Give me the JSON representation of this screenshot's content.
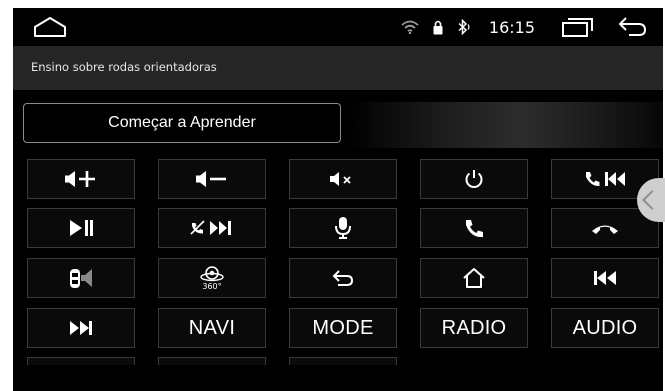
{
  "status": {
    "time": "16:15"
  },
  "header": {
    "title": "Ensino sobre rodas orientadoras"
  },
  "learn": {
    "start_label": "Começar a Aprender"
  },
  "keys": {
    "row1": [
      {
        "icon": "volume-up-icon"
      },
      {
        "icon": "volume-down-icon"
      },
      {
        "icon": "mute-icon"
      },
      {
        "icon": "power-icon"
      },
      {
        "icon": "call-prev-icon"
      }
    ],
    "row2": [
      {
        "icon": "play-pause-icon"
      },
      {
        "icon": "hangup-next-icon"
      },
      {
        "icon": "microphone-icon"
      },
      {
        "icon": "phone-answer-icon"
      },
      {
        "icon": "phone-hangup-icon"
      }
    ],
    "row3": [
      {
        "icon": "car-speaker-icon"
      },
      {
        "icon": "camera-360-icon",
        "label": "360°"
      },
      {
        "icon": "back-icon"
      },
      {
        "icon": "home-icon"
      },
      {
        "icon": "previous-track-icon"
      }
    ],
    "row4": [
      {
        "icon": "next-track-icon"
      },
      {
        "label": "NAVI"
      },
      {
        "label": "MODE"
      },
      {
        "label": "RADIO"
      },
      {
        "label": "AUDIO"
      }
    ]
  },
  "colors": {
    "background": "#000000",
    "titlebar": "#262626",
    "key_border": "#3a3a3a",
    "text": "#ffffff"
  }
}
